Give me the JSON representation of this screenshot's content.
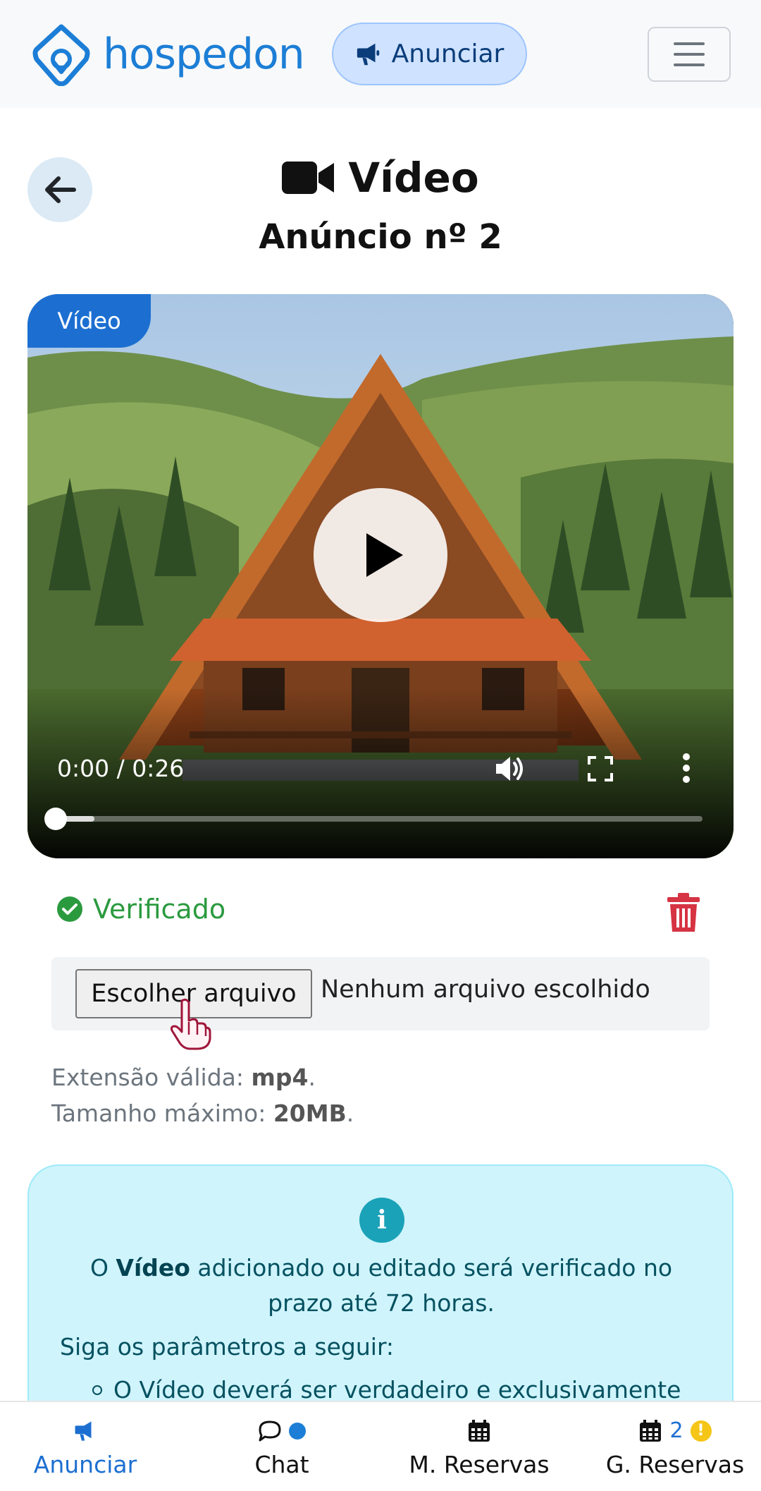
{
  "header": {
    "brand": "hospedon",
    "anunciar_label": "Anunciar",
    "logo_icon": "house-pin-logo-icon",
    "menu_icon": "hamburger-menu-icon",
    "brand_color": "#1c7ed6"
  },
  "page": {
    "title": "Vídeo",
    "title_icon": "video-camera-icon",
    "subtitle": "Anúncio nº 2",
    "back_icon": "arrow-left-icon"
  },
  "video": {
    "badge": "Vídeo",
    "time": "0:00 / 0:26",
    "progress_fraction": 0.0
  },
  "status": {
    "label": "Verificado",
    "color": "#2b9a3f"
  },
  "file_input": {
    "button_label": "Escolher arquivo",
    "status": "Nenhum arquivo escolhido"
  },
  "hints": {
    "extension_label": "Extensão válida: ",
    "extension_value": "mp4",
    "size_label": "Tamanho máximo: ",
    "size_value": "20MB"
  },
  "info": {
    "text_prefix": "O ",
    "text_bold": "Vídeo",
    "text_suffix": " adicionado ou editado será verificado no prazo até 72 horas.",
    "params_label": "Siga os parâmetros a seguir:",
    "bullet_1": "O Vídeo deverá ser verdadeiro e exclusivamente"
  },
  "bottom_nav": {
    "items": [
      {
        "label": "Anunciar",
        "icon": "megaphone-icon",
        "active": true
      },
      {
        "label": "Chat",
        "icon": "chat-bubble-icon"
      },
      {
        "label": "M. Reservas",
        "icon": "calendar-icon"
      },
      {
        "label": "G. Reservas",
        "icon": "calendar-icon",
        "badge": "2",
        "warning": "!"
      }
    ]
  }
}
